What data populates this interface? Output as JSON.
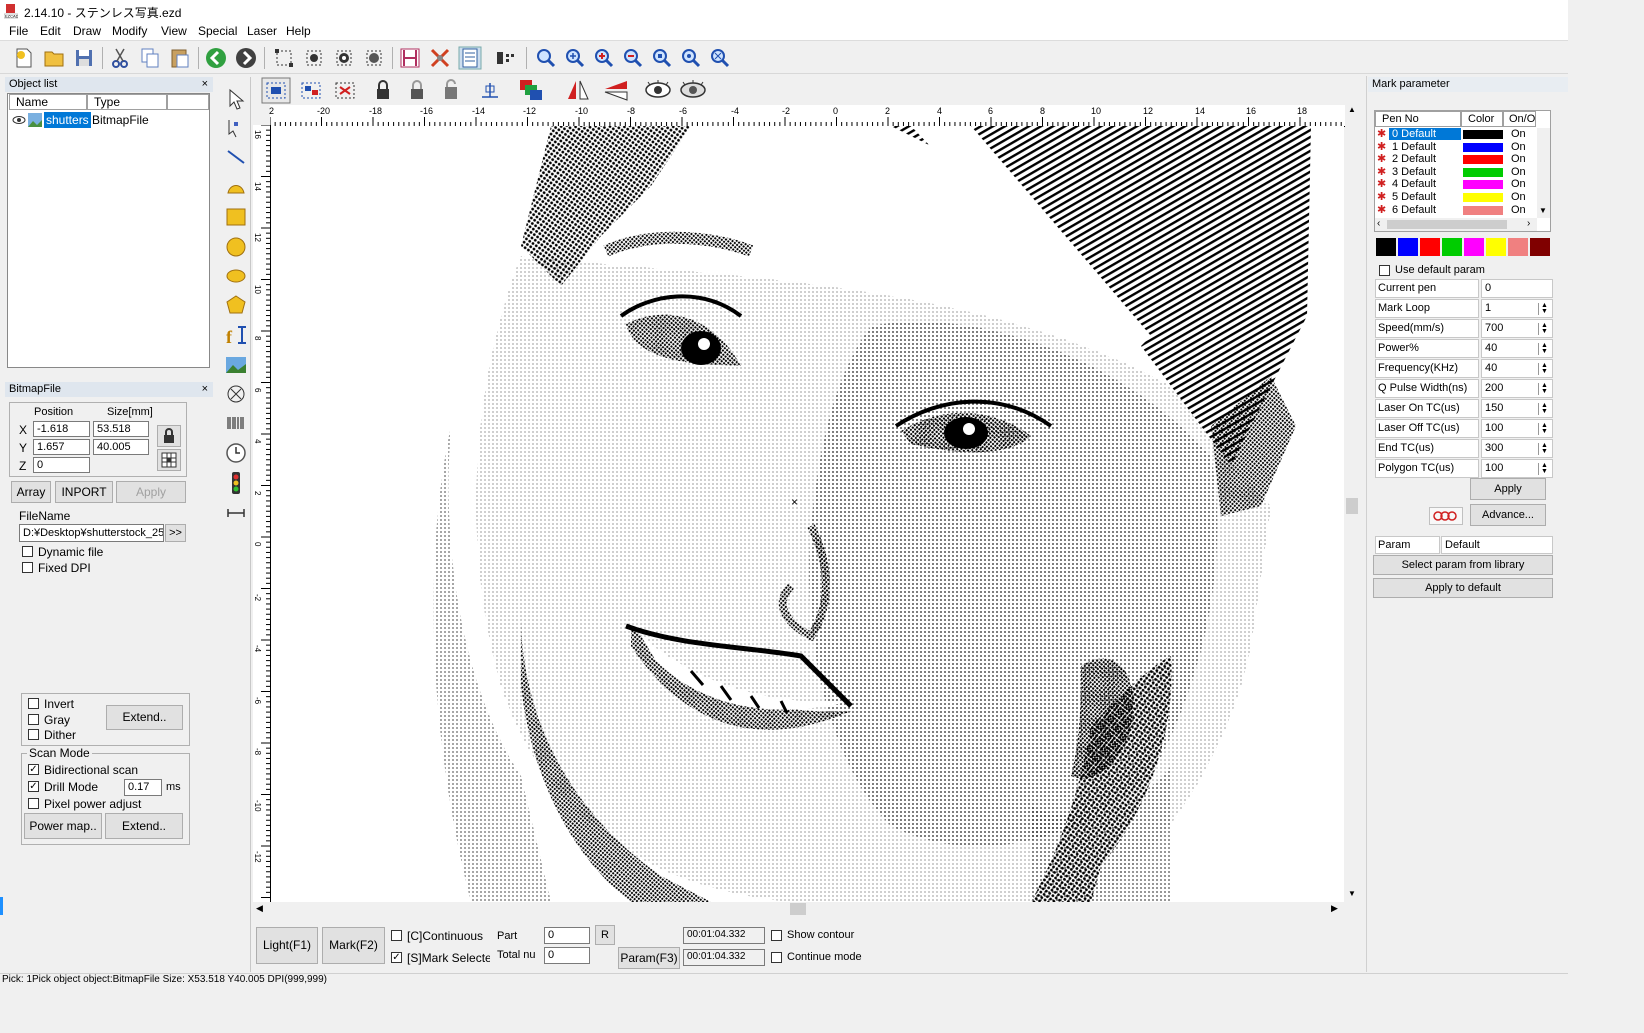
{
  "window": {
    "title": "2.14.10 - ステンレス写真.ezd"
  },
  "menu": [
    "File",
    "Edit",
    "Draw",
    "Modify",
    "View",
    "Special",
    "Laser",
    "Help"
  ],
  "toolbar_icons": [
    "new-file-icon",
    "open-folder-icon",
    "save-icon",
    "cut-icon",
    "copy-icon",
    "paste-icon",
    "back-icon",
    "forward-icon",
    "select-nodes-icon",
    "select-group-icon",
    "select-all-icon",
    "select-invert-icon",
    "hatch-icon",
    "tools-icon",
    "edit-list-icon",
    "barcode-settings-icon",
    "zoom-icon",
    "zoom-in-icon",
    "zoom-plus-icon",
    "zoom-out-icon",
    "zoom-fit-icon",
    "zoom-selected-icon",
    "zoom-all-icon"
  ],
  "object_list": {
    "title": "Object list",
    "close": "×",
    "columns": [
      "Name",
      "Type"
    ],
    "items": [
      {
        "name": "shutters",
        "type": "BitmapFile"
      }
    ]
  },
  "bitmap_panel": {
    "title": "BitmapFile",
    "close": "×",
    "position_label": "Position",
    "size_label": "Size[mm]",
    "x_label": "X",
    "y_label": "Y",
    "z_label": "Z",
    "x": "-1.618",
    "y": "1.657",
    "z": "0",
    "size_x": "53.518",
    "size_y": "40.005",
    "array_btn": "Array",
    "inport_btn": "INPORT",
    "apply_btn": "Apply",
    "filename_label": "FileName",
    "filename": "D:¥Desktop¥shutterstock_25",
    "browse_btn": ">>",
    "dynamic_file": "Dynamic file",
    "fixed_dpi": "Fixed DPI",
    "invert": "Invert",
    "gray": "Gray",
    "dither": "Dither",
    "extend_btn": "Extend..",
    "scan_mode": "Scan Mode",
    "bidirectional": "Bidirectional scan",
    "drill_mode": "Drill Mode",
    "drill_value": "0.17",
    "drill_unit": "ms",
    "pixel_power": "Pixel power adjust",
    "power_map_btn": "Power map..",
    "extend2_btn": "Extend.."
  },
  "ruler_h": [
    "2",
    "-20",
    "-18",
    "-16",
    "-14",
    "-12",
    "-10",
    "-8",
    "-6",
    "-4",
    "-2",
    "0",
    "2",
    "4",
    "6",
    "8",
    "10",
    "12",
    "14",
    "16",
    "18"
  ],
  "ruler_v": [
    "16",
    "14",
    "12",
    "10",
    "8",
    "6",
    "4",
    "2",
    "0",
    "-2",
    "-4",
    "-6",
    "-8",
    "-10",
    "-12",
    "-14"
  ],
  "mark_param": {
    "title": "Mark parameter",
    "columns": [
      "Pen No",
      "Color",
      "On/O"
    ],
    "pens": [
      {
        "no": "0 Default",
        "color": "#000000",
        "on": "On"
      },
      {
        "no": "1 Default",
        "color": "#0000ff",
        "on": "On"
      },
      {
        "no": "2 Default",
        "color": "#ff0000",
        "on": "On"
      },
      {
        "no": "3 Default",
        "color": "#00cc00",
        "on": "On"
      },
      {
        "no": "4 Default",
        "color": "#ff00ff",
        "on": "On"
      },
      {
        "no": "5 Default",
        "color": "#ffff00",
        "on": "On"
      },
      {
        "no": "6 Default",
        "color": "#f08080",
        "on": "On"
      }
    ],
    "swatches": [
      "#000000",
      "#0000ff",
      "#ff0000",
      "#00cc00",
      "#ff00ff",
      "#ffff00",
      "#f08080",
      "#800000"
    ],
    "use_default": "Use default param",
    "params": [
      {
        "label": "Current pen",
        "value": "0",
        "spin": false
      },
      {
        "label": "Mark Loop",
        "value": "1",
        "spin": true
      },
      {
        "label": "Speed(mm/s)",
        "value": "700",
        "spin": true
      },
      {
        "label": "Power%",
        "value": "40",
        "spin": true
      },
      {
        "label": "Frequency(KHz)",
        "value": "40",
        "spin": true
      },
      {
        "label": "Q Pulse Width(ns)",
        "value": "200",
        "spin": true
      },
      {
        "label": "Laser On TC(us)",
        "value": "150",
        "spin": true
      },
      {
        "label": "Laser Off TC(us)",
        "value": "100",
        "spin": true
      },
      {
        "label": "End TC(us)",
        "value": "300",
        "spin": true
      },
      {
        "label": "Polygon TC(us)",
        "value": "100",
        "spin": true
      }
    ],
    "apply_btn": "Apply",
    "advance_btn": "Advance...",
    "param_name_label": "Param name",
    "param_name_value": "Default",
    "select_library_btn": "Select param from library",
    "apply_default_btn": "Apply to default"
  },
  "bottom": {
    "light_btn": "Light(F1)",
    "mark_btn": "Mark(F2)",
    "continuous": "[C]Continuous",
    "mark_selected": "[S]Mark Selectec",
    "part_label": "Part",
    "part_value": "0",
    "r_btn": "R",
    "total_label": "Total nu",
    "total_value": "0",
    "param_btn": "Param(F3)",
    "time1": "00:01:04.332",
    "time2": "00:01:04.332",
    "show_contour": "Show contour",
    "continue_mode": "Continue mode"
  },
  "status": "Pick: 1Pick object object:BitmapFile Size: X53.518 Y40.005 DPI(999,999)"
}
